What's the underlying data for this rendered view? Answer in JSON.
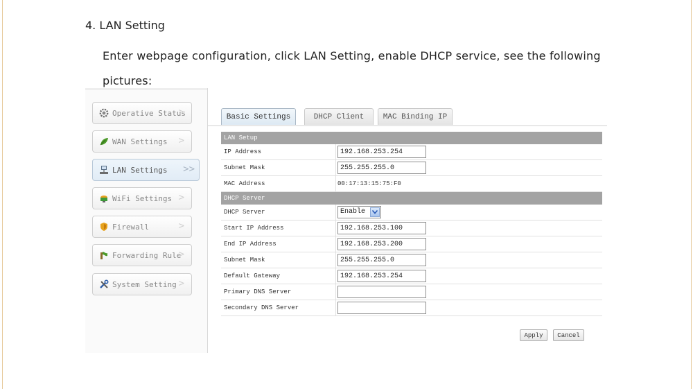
{
  "document": {
    "heading": "4.  LAN Setting",
    "paragraph": "Enter webpage configuration, click LAN Setting, enable DHCP service, see the following pictures:"
  },
  "sidebar": {
    "items": [
      {
        "label": "Operative Status",
        "icon": "gear-icon",
        "active": false
      },
      {
        "label": "WAN Settings",
        "icon": "leaf-icon",
        "active": false
      },
      {
        "label": "LAN Settings",
        "icon": "network-icon",
        "active": true
      },
      {
        "label": "WiFi Settings",
        "icon": "router-icon",
        "active": false
      },
      {
        "label": "Firewall",
        "icon": "shield-icon",
        "active": false
      },
      {
        "label": "Forwarding Rule",
        "icon": "forwarding-icon",
        "active": false
      },
      {
        "label": "System Setting",
        "icon": "tools-icon",
        "active": false
      }
    ],
    "arrow": ">",
    "active_arrow": ">>"
  },
  "tabs": [
    {
      "label": "Basic Settings",
      "active": true
    },
    {
      "label": "DHCP Client",
      "active": false
    },
    {
      "label": "MAC Binding IP",
      "active": false
    }
  ],
  "lan_setup": {
    "section_title": "LAN Setup",
    "ip_address": {
      "label": "IP Address",
      "value": "192.168.253.254"
    },
    "subnet_mask": {
      "label": "Subnet Mask",
      "value": "255.255.255.0"
    },
    "mac_address": {
      "label": "MAC Address",
      "value": "00:17:13:15:75:F0"
    }
  },
  "dhcp_server": {
    "section_title": "DHCP Server",
    "dhcp_server": {
      "label": "DHCP Server",
      "value": "Enable"
    },
    "start_ip": {
      "label": "Start IP Address",
      "value": "192.168.253.100"
    },
    "end_ip": {
      "label": "End IP Address",
      "value": "192.168.253.200"
    },
    "subnet_mask": {
      "label": "Subnet Mask",
      "value": "255.255.255.0"
    },
    "default_gateway": {
      "label": "Default Gateway",
      "value": "192.168.253.254"
    },
    "primary_dns": {
      "label": "Primary DNS Server",
      "value": ""
    },
    "secondary_dns": {
      "label": "Secondary DNS Server",
      "value": ""
    }
  },
  "buttons": {
    "apply": "Apply",
    "cancel": "Cancel"
  },
  "colors": {
    "section_header": "#a3a3a3",
    "select_arrow": "#2a5bb5",
    "page_rule": "#e6c99a"
  }
}
